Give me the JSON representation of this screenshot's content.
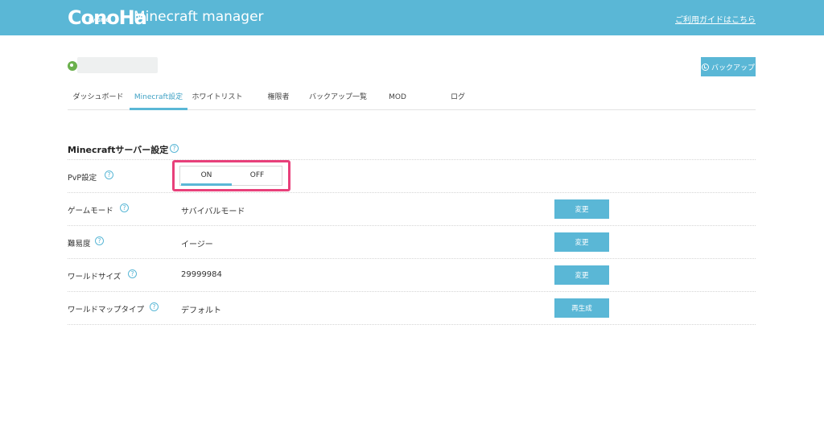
{
  "header": {
    "logo_text": "ConoHa",
    "logo_sub": "by GMO",
    "app_title": "Minecraft manager",
    "guide_link": "ご利用ガイドはこちら"
  },
  "server": {
    "backup_button": "バックアップ"
  },
  "tabs": [
    {
      "label": "ダッシュボード",
      "active": false
    },
    {
      "label": "Minecraft設定",
      "active": true
    },
    {
      "label": "ホワイトリスト",
      "active": false
    },
    {
      "label": "権限者",
      "active": false
    },
    {
      "label": "バックアップ一覧",
      "active": false
    },
    {
      "label": "MOD",
      "active": false
    },
    {
      "label": "ログ",
      "active": false
    }
  ],
  "section": {
    "title": "Minecraftサーバー設定",
    "help": "?"
  },
  "settings": {
    "pvp": {
      "label": "PvP設定",
      "on": "ON",
      "off": "OFF",
      "selected": "ON"
    },
    "game_mode": {
      "label": "ゲームモード",
      "value": "サバイバルモード",
      "button": "変更"
    },
    "difficulty": {
      "label": "難易度",
      "value": "イージー",
      "button": "変更"
    },
    "world_size": {
      "label": "ワールドサイズ",
      "value": "29999984",
      "button": "変更"
    },
    "world_map_type": {
      "label": "ワールドマップタイプ",
      "value": "デフォルト",
      "button": "再生成"
    }
  },
  "colors": {
    "accent": "#5ab7d6",
    "highlight": "#e8407a",
    "status_green": "#6ab04c"
  }
}
